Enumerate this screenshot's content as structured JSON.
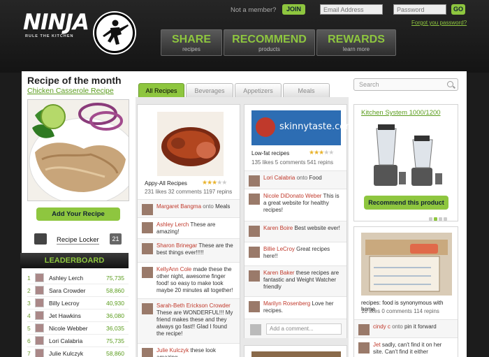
{
  "header": {
    "logo_text": "NINJA",
    "tagline": "RULE THE KITCHEN",
    "not_member": "Not a member?",
    "join_label": "JOIN",
    "email_placeholder": "Email Address",
    "password_placeholder": "Password",
    "go_label": "GO",
    "forgot_label": "Forgot you password?"
  },
  "nav": [
    {
      "title": "SHARE",
      "sub": "recipes"
    },
    {
      "title": "RECOMMEND",
      "sub": "products"
    },
    {
      "title": "REWARDS",
      "sub": "learn more"
    }
  ],
  "sidebar": {
    "rotm_title": "Recipe of the month",
    "rotm_link": "Chicken Casserole Recipe",
    "add_recipe": "Add Your Recipe",
    "locker_label": "Recipe Locker",
    "locker_count": "21",
    "leaderboard_title": "LEADERBOARD",
    "leaders": [
      {
        "rank": "1",
        "name": "Ashley Lerch",
        "points": "75,735"
      },
      {
        "rank": "2",
        "name": "Sara Crowder",
        "points": "58,860"
      },
      {
        "rank": "3",
        "name": "Billy Lecroy",
        "points": "40,930"
      },
      {
        "rank": "4",
        "name": "Jet Hawkins",
        "points": "36,080"
      },
      {
        "rank": "5",
        "name": "Nicole Webber",
        "points": "36,035"
      },
      {
        "rank": "6",
        "name": "Lori Calabria",
        "points": "75,735"
      },
      {
        "rank": "7",
        "name": "Julie Kulczyk",
        "points": "58,860"
      }
    ]
  },
  "tabs": [
    "All Recipes",
    "Beverages",
    "Appetizers",
    "Meals"
  ],
  "search_placeholder": "Search",
  "pins": [
    {
      "title": "Appy-All Recipes",
      "stars_on": "★★★",
      "stars_off": "★★",
      "stats": "231 likes  32 comments  1197 repins",
      "comments": [
        {
          "name": "Margaret Bangma",
          "onto": "onto",
          "board": "Meals",
          "text": ""
        },
        {
          "name": "Ashley Lerch",
          "text": "These are amazing!"
        },
        {
          "name": "Sharon Brinegar",
          "text": "These are the best things ever!!!!!"
        },
        {
          "name": "KellyAnn Cole",
          "text": "made these the other night, awesome finger food! so easy to make took maybe 20 minutes all together!"
        },
        {
          "name": "Sarah-Beth Erickson Crowder",
          "text": "These are WONDERFUL!!! My friend makes these and they always go fast!! Glad I found the recipe!"
        },
        {
          "name": "Julie Kulczyk",
          "text": "these look amazing"
        }
      ]
    },
    {
      "title": "Low-fat recipes",
      "brand": "skinnytaste.com",
      "stars_on": "★★★",
      "stars_off": "★★",
      "stats": "135 likes  5 comments  541 repins",
      "comments": [
        {
          "name": "Lori Calabria",
          "onto": "onto",
          "board": "Food",
          "text": ""
        },
        {
          "name": "Nicole DiDonato Weber",
          "text": "This is a great website for healthy recipes!"
        },
        {
          "name": "Karen Boire",
          "text": "Best website ever!"
        },
        {
          "name": "Billie LeCroy",
          "text": "Great recipes here!!"
        },
        {
          "name": "Karen Baker",
          "text": "these recipes are fantastic and Weight Watcher friendly"
        },
        {
          "name": "Marilyn Rosenberg",
          "text": "Love her recipes."
        }
      ],
      "add_comment_placeholder": "Add a comment..."
    }
  ],
  "right": {
    "ad_title": "Kitchen System 1000/1200",
    "ad_button": "Recommend this product",
    "pin_title": "recipes: food is synonymous with home",
    "pin_stats": "16 likes  0 comments  114 repins",
    "comment1_name": "cindy c",
    "comment1_onto": "onto",
    "comment1_board": "pin it forward",
    "comment2_name": "Jet",
    "comment2_text": "sadly, can't find it on her site. Can't find it either"
  },
  "colors": {
    "accent": "#8ec63f",
    "link": "#5a9c1c",
    "name": "#c0392b"
  }
}
